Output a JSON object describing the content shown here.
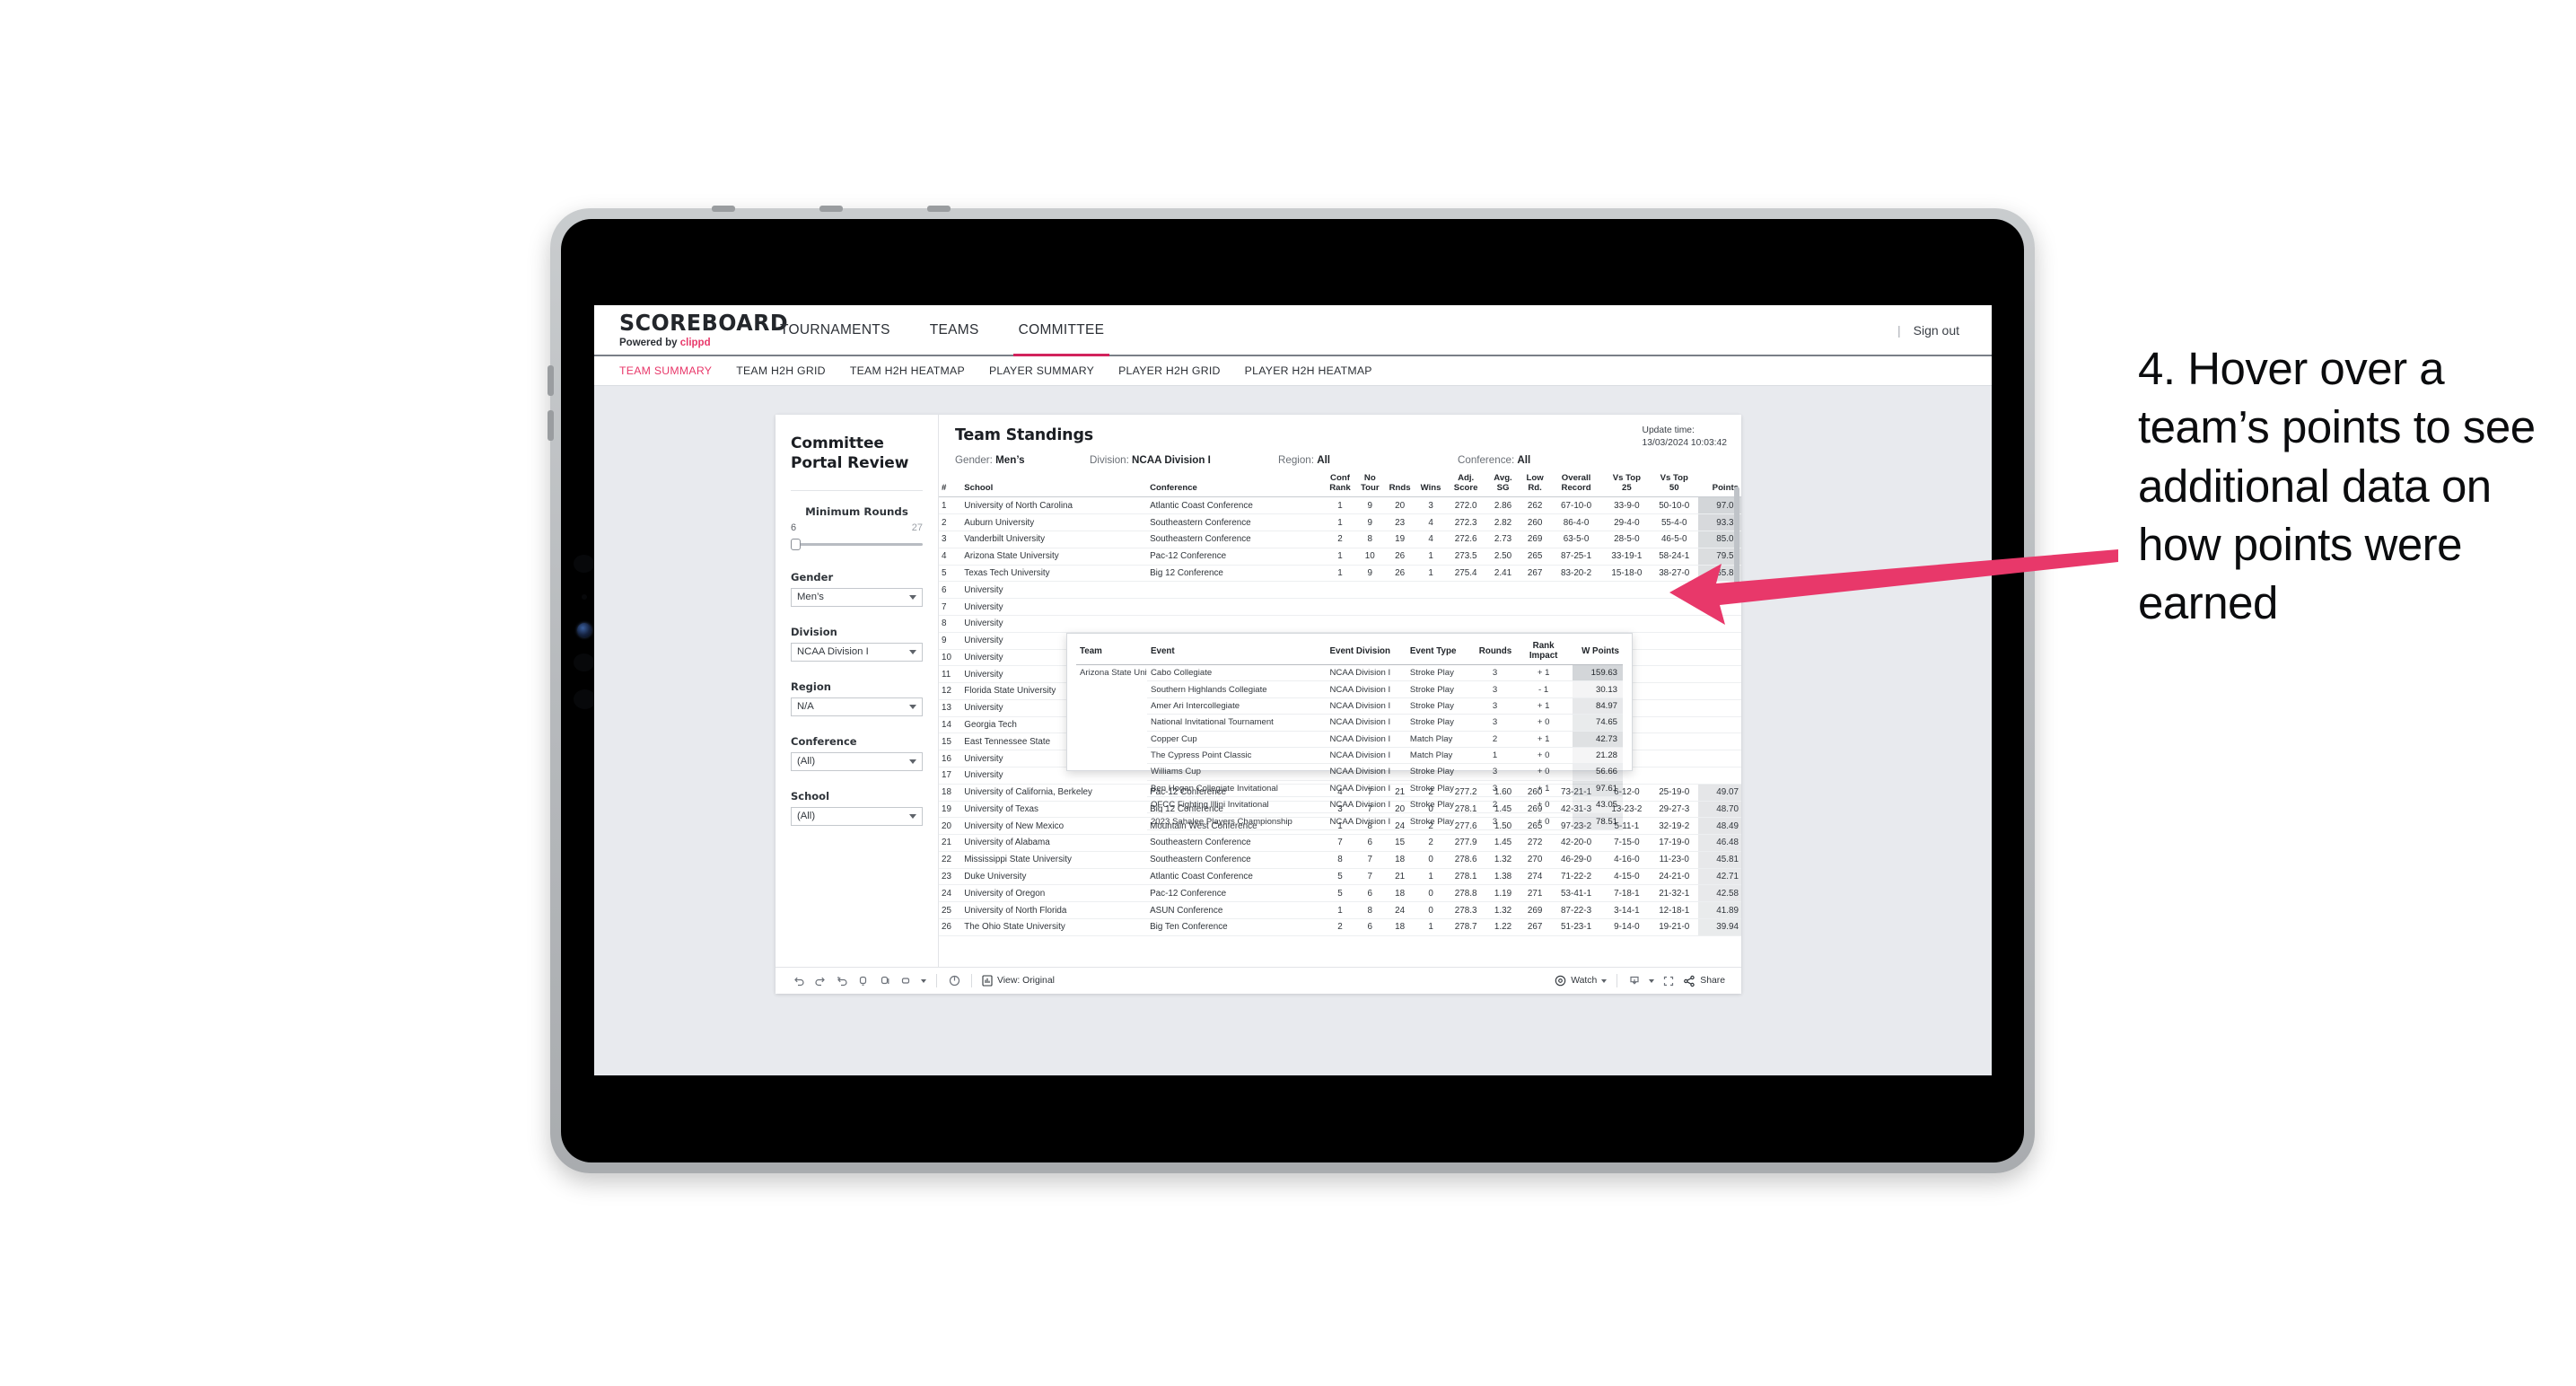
{
  "annotation": {
    "text": "4. Hover over a team’s points to see additional data on how points were earned",
    "arrow_color": "#e8386a"
  },
  "brand": {
    "title": "SCOREBOARD",
    "powered_prefix": "Powered by ",
    "powered_name": "clippd",
    "accent": "#e8386a"
  },
  "topnav": {
    "items": [
      {
        "label": "TOURNAMENTS",
        "active": false
      },
      {
        "label": "TEAMS",
        "active": false
      },
      {
        "label": "COMMITTEE",
        "active": true
      }
    ],
    "separator": "|",
    "sign_out": "Sign out"
  },
  "subtabs": [
    {
      "label": "TEAM SUMMARY",
      "active": true
    },
    {
      "label": "TEAM H2H GRID",
      "active": false
    },
    {
      "label": "TEAM H2H HEATMAP",
      "active": false
    },
    {
      "label": "PLAYER SUMMARY",
      "active": false
    },
    {
      "label": "PLAYER H2H GRID",
      "active": false
    },
    {
      "label": "PLAYER H2H HEATMAP",
      "active": false
    }
  ],
  "filters": {
    "title": "Committee Portal Review",
    "slider": {
      "label": "Minimum Rounds",
      "min": "6",
      "max": "27",
      "value": "6"
    },
    "groups": [
      {
        "label": "Gender",
        "value": "Men’s"
      },
      {
        "label": "Division",
        "value": "NCAA Division I"
      },
      {
        "label": "Region",
        "value": "N/A"
      },
      {
        "label": "Conference",
        "value": "(All)"
      },
      {
        "label": "School",
        "value": "(All)"
      }
    ]
  },
  "standings": {
    "title": "Team Standings",
    "update_label": "Update time:",
    "update_value": "13/03/2024 10:03:42",
    "summary": [
      {
        "key": "Gender:",
        "value": "Men’s"
      },
      {
        "key": "Division:",
        "value": "NCAA Division I"
      },
      {
        "key": "Region:",
        "value": "All"
      },
      {
        "key": "Conference:",
        "value": "All"
      }
    ],
    "columns": [
      "#",
      "School",
      "Conference",
      "Conf Rank",
      "No Tour",
      "Rnds",
      "Wins",
      "Adj. Score",
      "Avg. SG",
      "Low Rd.",
      "Overall Record",
      "Vs Top 25",
      "Vs Top 50",
      "Points"
    ],
    "rows": [
      {
        "n": "1",
        "school": "University of North Carolina",
        "conf": "Atlantic Coast Conference",
        "cr": "1",
        "nt": "9",
        "rnds": "20",
        "wins": "3",
        "adj": "272.0",
        "sg": "2.86",
        "low": "262",
        "ovr": "67-10-0",
        "t25": "33-9-0",
        "t50": "50-10-0",
        "pts": "97.02",
        "shade": 0.3
      },
      {
        "n": "2",
        "school": "Auburn University",
        "conf": "Southeastern Conference",
        "cr": "1",
        "nt": "9",
        "rnds": "23",
        "wins": "4",
        "adj": "272.3",
        "sg": "2.82",
        "low": "260",
        "ovr": "86-4-0",
        "t25": "29-4-0",
        "t50": "55-4-0",
        "pts": "93.31",
        "shade": 0.28
      },
      {
        "n": "3",
        "school": "Vanderbilt University",
        "conf": "Southeastern Conference",
        "cr": "2",
        "nt": "8",
        "rnds": "19",
        "wins": "4",
        "adj": "272.6",
        "sg": "2.73",
        "low": "269",
        "ovr": "63-5-0",
        "t25": "28-5-0",
        "t50": "46-5-0",
        "pts": "85.02",
        "shade": 0.26
      },
      {
        "n": "4",
        "school": "Arizona State University",
        "conf": "Pac-12 Conference",
        "cr": "1",
        "nt": "10",
        "rnds": "26",
        "wins": "1",
        "adj": "273.5",
        "sg": "2.50",
        "low": "265",
        "ovr": "87-25-1",
        "t25": "33-19-1",
        "t50": "58-24-1",
        "pts": "79.52",
        "shade": 0.25
      },
      {
        "n": "5",
        "school": "Texas Tech University",
        "conf": "Big 12 Conference",
        "cr": "1",
        "nt": "9",
        "rnds": "26",
        "wins": "1",
        "adj": "275.4",
        "sg": "2.41",
        "low": "267",
        "ovr": "83-20-2",
        "t25": "15-18-0",
        "t50": "38-27-0",
        "pts": "65.80",
        "shade": 0.22
      },
      {
        "n": "6",
        "school": "University",
        "conf": "",
        "cr": "",
        "nt": "",
        "rnds": "",
        "wins": "",
        "adj": "",
        "sg": "",
        "low": "",
        "ovr": "",
        "t25": "",
        "t50": "",
        "pts": "",
        "shade": 0
      },
      {
        "n": "7",
        "school": "University",
        "conf": "",
        "cr": "",
        "nt": "",
        "rnds": "",
        "wins": "",
        "adj": "",
        "sg": "",
        "low": "",
        "ovr": "",
        "t25": "",
        "t50": "",
        "pts": "",
        "shade": 0
      },
      {
        "n": "8",
        "school": "University",
        "conf": "",
        "cr": "",
        "nt": "",
        "rnds": "",
        "wins": "",
        "adj": "",
        "sg": "",
        "low": "",
        "ovr": "",
        "t25": "",
        "t50": "",
        "pts": "",
        "shade": 0
      },
      {
        "n": "9",
        "school": "University",
        "conf": "",
        "cr": "",
        "nt": "",
        "rnds": "",
        "wins": "",
        "adj": "",
        "sg": "",
        "low": "",
        "ovr": "",
        "t25": "",
        "t50": "",
        "pts": "",
        "shade": 0
      },
      {
        "n": "10",
        "school": "University",
        "conf": "",
        "cr": "",
        "nt": "",
        "rnds": "",
        "wins": "",
        "adj": "",
        "sg": "",
        "low": "",
        "ovr": "",
        "t25": "",
        "t50": "",
        "pts": "",
        "shade": 0
      },
      {
        "n": "11",
        "school": "University",
        "conf": "",
        "cr": "",
        "nt": "",
        "rnds": "",
        "wins": "",
        "adj": "",
        "sg": "",
        "low": "",
        "ovr": "",
        "t25": "",
        "t50": "",
        "pts": "",
        "shade": 0
      },
      {
        "n": "12",
        "school": "Florida State University",
        "conf": "",
        "cr": "",
        "nt": "",
        "rnds": "",
        "wins": "",
        "adj": "",
        "sg": "",
        "low": "",
        "ovr": "",
        "t25": "",
        "t50": "",
        "pts": "",
        "shade": 0
      },
      {
        "n": "13",
        "school": "University",
        "conf": "",
        "cr": "",
        "nt": "",
        "rnds": "",
        "wins": "",
        "adj": "",
        "sg": "",
        "low": "",
        "ovr": "",
        "t25": "",
        "t50": "",
        "pts": "",
        "shade": 0
      },
      {
        "n": "14",
        "school": "Georgia Tech",
        "conf": "",
        "cr": "",
        "nt": "",
        "rnds": "",
        "wins": "",
        "adj": "",
        "sg": "",
        "low": "",
        "ovr": "",
        "t25": "",
        "t50": "",
        "pts": "",
        "shade": 0
      },
      {
        "n": "15",
        "school": "East Tennessee State",
        "conf": "",
        "cr": "",
        "nt": "",
        "rnds": "",
        "wins": "",
        "adj": "",
        "sg": "",
        "low": "",
        "ovr": "",
        "t25": "",
        "t50": "",
        "pts": "",
        "shade": 0
      },
      {
        "n": "16",
        "school": "University",
        "conf": "",
        "cr": "",
        "nt": "",
        "rnds": "",
        "wins": "",
        "adj": "",
        "sg": "",
        "low": "",
        "ovr": "",
        "t25": "",
        "t50": "",
        "pts": "",
        "shade": 0
      },
      {
        "n": "17",
        "school": "University",
        "conf": "",
        "cr": "",
        "nt": "",
        "rnds": "",
        "wins": "",
        "adj": "",
        "sg": "",
        "low": "",
        "ovr": "",
        "t25": "",
        "t50": "",
        "pts": "",
        "shade": 0
      },
      {
        "n": "18",
        "school": "University of California, Berkeley",
        "conf": "Pac-12 Conference",
        "cr": "4",
        "nt": "7",
        "rnds": "21",
        "wins": "2",
        "adj": "277.2",
        "sg": "1.60",
        "low": "260",
        "ovr": "73-21-1",
        "t25": "6-12-0",
        "t50": "25-19-0",
        "pts": "49.07",
        "shade": 0.18
      },
      {
        "n": "19",
        "school": "University of Texas",
        "conf": "Big 12 Conference",
        "cr": "3",
        "nt": "7",
        "rnds": "20",
        "wins": "0",
        "adj": "278.1",
        "sg": "1.45",
        "low": "269",
        "ovr": "42-31-3",
        "t25": "13-23-2",
        "t50": "29-27-3",
        "pts": "48.70",
        "shade": 0.18
      },
      {
        "n": "20",
        "school": "University of New Mexico",
        "conf": "Mountain West Conference",
        "cr": "1",
        "nt": "8",
        "rnds": "24",
        "wins": "2",
        "adj": "277.6",
        "sg": "1.50",
        "low": "265",
        "ovr": "97-23-2",
        "t25": "5-11-1",
        "t50": "32-19-2",
        "pts": "48.49",
        "shade": 0.18
      },
      {
        "n": "21",
        "school": "University of Alabama",
        "conf": "Southeastern Conference",
        "cr": "7",
        "nt": "6",
        "rnds": "15",
        "wins": "2",
        "adj": "277.9",
        "sg": "1.45",
        "low": "272",
        "ovr": "42-20-0",
        "t25": "7-15-0",
        "t50": "17-19-0",
        "pts": "46.48",
        "shade": 0.17
      },
      {
        "n": "22",
        "school": "Mississippi State University",
        "conf": "Southeastern Conference",
        "cr": "8",
        "nt": "7",
        "rnds": "18",
        "wins": "0",
        "adj": "278.6",
        "sg": "1.32",
        "low": "270",
        "ovr": "46-29-0",
        "t25": "4-16-0",
        "t50": "11-23-0",
        "pts": "45.81",
        "shade": 0.17
      },
      {
        "n": "23",
        "school": "Duke University",
        "conf": "Atlantic Coast Conference",
        "cr": "5",
        "nt": "7",
        "rnds": "21",
        "wins": "1",
        "adj": "278.1",
        "sg": "1.38",
        "low": "274",
        "ovr": "71-22-2",
        "t25": "4-15-0",
        "t50": "24-21-0",
        "pts": "42.71",
        "shade": 0.16
      },
      {
        "n": "24",
        "school": "University of Oregon",
        "conf": "Pac-12 Conference",
        "cr": "5",
        "nt": "6",
        "rnds": "18",
        "wins": "0",
        "adj": "278.8",
        "sg": "1.19",
        "low": "271",
        "ovr": "53-41-1",
        "t25": "7-18-1",
        "t50": "21-32-1",
        "pts": "42.58",
        "shade": 0.16
      },
      {
        "n": "25",
        "school": "University of North Florida",
        "conf": "ASUN Conference",
        "cr": "1",
        "nt": "8",
        "rnds": "24",
        "wins": "0",
        "adj": "278.3",
        "sg": "1.32",
        "low": "269",
        "ovr": "87-22-3",
        "t25": "3-14-1",
        "t50": "12-18-1",
        "pts": "41.89",
        "shade": 0.15
      },
      {
        "n": "26",
        "school": "The Ohio State University",
        "conf": "Big Ten Conference",
        "cr": "2",
        "nt": "6",
        "rnds": "18",
        "wins": "1",
        "adj": "278.7",
        "sg": "1.22",
        "low": "267",
        "ovr": "51-23-1",
        "t25": "9-14-0",
        "t50": "19-21-0",
        "pts": "39.94",
        "shade": 0.15
      }
    ]
  },
  "tooltip": {
    "columns": [
      "Team",
      "Event",
      "Event Division",
      "Event Type",
      "Rounds",
      "Rank Impact",
      "W Points"
    ],
    "team": "Arizona State University",
    "rows": [
      {
        "event": "Cabo Collegiate",
        "division": "NCAA Division I",
        "type": "Stroke Play",
        "rounds": "3",
        "impact": "+ 1",
        "points": "159.63",
        "shade": 0.3
      },
      {
        "event": "Southern Highlands Collegiate",
        "division": "NCAA Division I",
        "type": "Stroke Play",
        "rounds": "3",
        "impact": "- 1",
        "points": "30.13",
        "shade": 0.08
      },
      {
        "event": "Amer Ari Intercollegiate",
        "division": "NCAA Division I",
        "type": "Stroke Play",
        "rounds": "3",
        "impact": "+ 1",
        "points": "84.97",
        "shade": 0.17
      },
      {
        "event": "National Invitational Tournament",
        "division": "NCAA Division I",
        "type": "Stroke Play",
        "rounds": "3",
        "impact": "+ 0",
        "points": "74.65",
        "shade": 0.15
      },
      {
        "event": "Copper Cup",
        "division": "NCAA Division I",
        "type": "Match Play",
        "rounds": "2",
        "impact": "+ 1",
        "points": "42.73",
        "shade": 0.22
      },
      {
        "event": "The Cypress Point Classic",
        "division": "NCAA Division I",
        "type": "Match Play",
        "rounds": "1",
        "impact": "+ 0",
        "points": "21.28",
        "shade": 0.07
      },
      {
        "event": "Williams Cup",
        "division": "NCAA Division I",
        "type": "Stroke Play",
        "rounds": "3",
        "impact": "+ 0",
        "points": "56.66",
        "shade": 0.12
      },
      {
        "event": "Ben Hogan Collegiate Invitational",
        "division": "NCAA Division I",
        "type": "Stroke Play",
        "rounds": "3",
        "impact": "+ 1",
        "points": "97.61",
        "shade": 0.2
      },
      {
        "event": "OFCC Fighting Illini Invitational",
        "division": "NCAA Division I",
        "type": "Stroke Play",
        "rounds": "2",
        "impact": "+ 0",
        "points": "43.05",
        "shade": 0.1
      },
      {
        "event": "2023 Sahalee Players Championship",
        "division": "NCAA Division I",
        "type": "Stroke Play",
        "rounds": "3",
        "impact": "+ 0",
        "points": "78.51",
        "shade": 0.16
      }
    ]
  },
  "toolbar": {
    "view_label": "View: Original",
    "watch_label": "Watch",
    "share_label": "Share"
  }
}
